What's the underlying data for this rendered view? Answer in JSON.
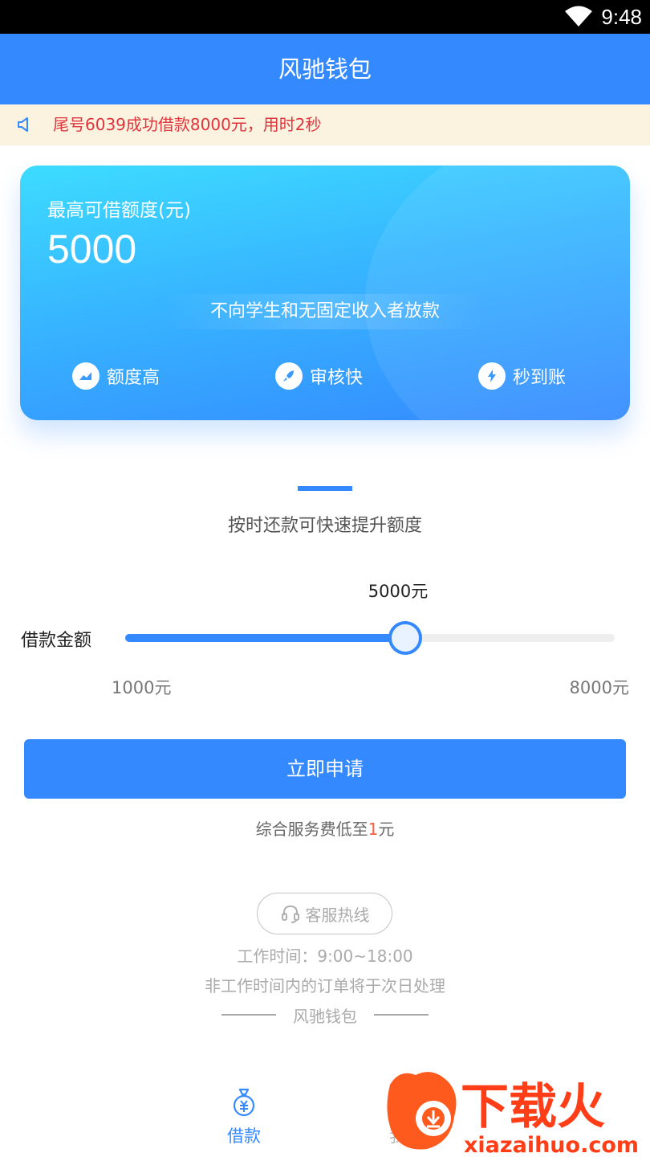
{
  "status_bar": {
    "time": "9:48",
    "wifi_icon": "wifi-icon"
  },
  "app_bar": {
    "title": "风驰钱包"
  },
  "notice": {
    "icon": "speaker-icon",
    "text": "尾号6039成功借款8000元，用时2秒"
  },
  "card": {
    "label": "最高可借额度(元)",
    "amount": "5000",
    "banner": "不向学生和无固定收入者放款",
    "features": [
      {
        "icon": "chart-icon",
        "label": "额度高"
      },
      {
        "icon": "rocket-icon",
        "label": "审核快"
      },
      {
        "icon": "lightning-icon",
        "label": "秒到账"
      }
    ]
  },
  "tip": "按时还款可快速提升额度",
  "slider": {
    "label": "借款金额",
    "value_text": "5000元",
    "value": 5000,
    "min": 1000,
    "max": 8000,
    "min_text": "1000元",
    "max_text": "8000元"
  },
  "apply_button": "立即申请",
  "fee": {
    "prefix": "综合服务费低至",
    "amount": "1",
    "suffix": "元"
  },
  "footer": {
    "hotline": "客服热线",
    "hotline_icon": "headset-icon",
    "work_hours": "工作时间：9:00~18:00",
    "offhours_note": "非工作时间内的订单将于次日处理",
    "brand": "风驰钱包"
  },
  "tabs": [
    {
      "icon": "money-bag-icon",
      "label": "借款",
      "active": true
    },
    {
      "icon": "user-icon",
      "label": "我的",
      "active": false
    }
  ],
  "watermark": {
    "text": "下载火",
    "site": "xiazaihuo.com"
  },
  "colors": {
    "primary": "#3489ff",
    "notice_text": "#e0353c",
    "fee_highlight": "#ff5a3c"
  }
}
